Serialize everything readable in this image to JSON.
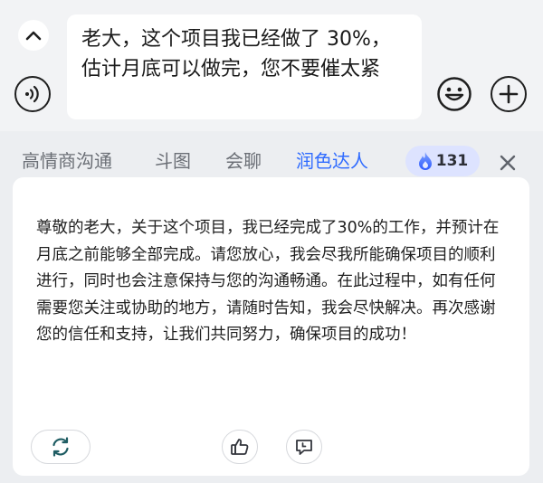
{
  "input": {
    "text": "老大，这个项目我已经做了 30%，估计月底可以做完，您不要催太紧"
  },
  "tabs": [
    {
      "label": "高情商沟通",
      "active": false
    },
    {
      "label": "斗图",
      "active": false
    },
    {
      "label": "会聊",
      "active": false
    },
    {
      "label": "润色达人",
      "active": true
    }
  ],
  "badge": {
    "count": "131",
    "icon": "flame-icon"
  },
  "result": {
    "text": "尊敬的老大，关于这个项目，我已经完成了30%的工作，并预计在月底之前能够全部完成。请您放心，我会尽我所能确保项目的顺利进行，同时也会注意保持与您的沟通畅通。在此过程中，如有任何需要您关注或协助的地方，请随时告知，我会尽快解决。再次感谢您的信任和支持，让我们共同努力，确保项目的成功！"
  },
  "colors": {
    "accent": "#2f6bff",
    "badge_bg": "#dde3ff",
    "panel_bg": "#eceef1"
  }
}
